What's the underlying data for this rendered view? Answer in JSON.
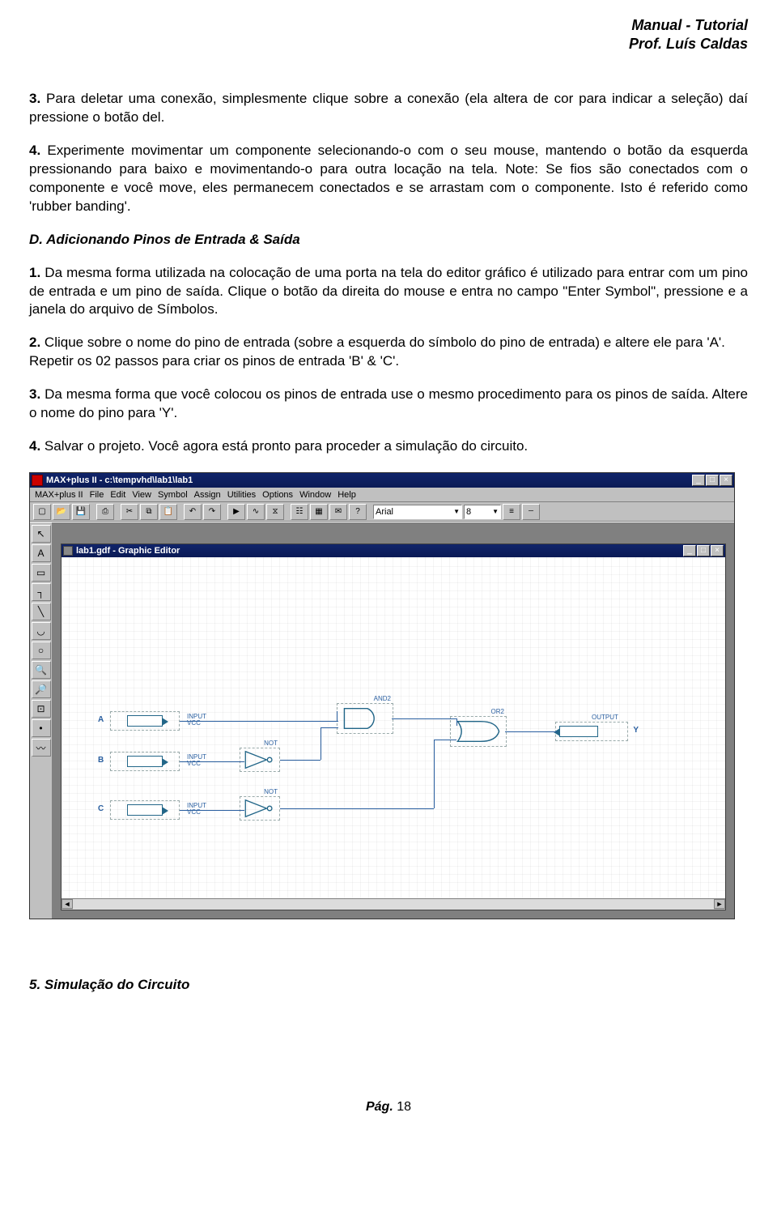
{
  "header": {
    "line1": "Manual - Tutorial",
    "line2": "Prof. Luís Caldas"
  },
  "paragraphs": {
    "p3_num": "3.",
    "p3_text": " Para deletar uma conexão, simplesmente clique sobre a conexão (ela altera de cor para indicar a seleção) daí pressione o botão del.",
    "p4_num": "4.",
    "p4_text": " Experimente movimentar um componente selecionando-o com o seu mouse, mantendo o botão da esquerda pressionando para baixo e movimentando-o para outra locação na tela. Note: Se fios são conectados com o componente e você move, eles permanecem conectados e se arrastam com o componente. Isto é referido como  'rubber banding'.",
    "sectionD": "D. Adicionando Pinos de Entrada & Saída",
    "d1_num": "1.",
    "d1_text": " Da mesma forma utilizada na colocação de uma porta na tela do editor gráfico é utilizado para entrar com um pino de entrada e um pino de saída. Clique o botão da direita do mouse e entra no campo \"Enter Symbol\", pressione e a janela do arquivo de Símbolos.",
    "d2_num": "2.",
    "d2_text_a": " Clique sobre o nome do pino de entrada (sobre a esquerda do símbolo do pino de entrada) e altere ele para 'A'.",
    "d2_text_b": "Repetir os 02 passos para criar os pinos de entrada 'B' & 'C'.",
    "d3_num": "3.",
    "d3_text": " Da mesma forma que você colocou os pinos de entrada use o mesmo procedimento para os pinos de saída. Altere o nome do pino para 'Y'.",
    "d4_num": "4.",
    "d4_text": " Salvar o projeto. Você agora está pronto para proceder a simulação do circuito.",
    "section5": "5. Simulação do Circuito"
  },
  "app": {
    "title": "MAX+plus II - c:\\tempvhd\\lab1\\lab1",
    "menubar": [
      "MAX+plus II",
      "File",
      "Edit",
      "View",
      "Symbol",
      "Assign",
      "Utilities",
      "Options",
      "Window",
      "Help"
    ],
    "font_select": "Arial",
    "size_select": "8",
    "child_title": "lab1.gdf - Graphic Editor",
    "pins": {
      "a": "A",
      "b": "B",
      "c": "C",
      "y": "Y",
      "input_tag": "INPUT",
      "vcc_tag": "VCC"
    },
    "gates": {
      "and2": "AND2",
      "not1": "NOT",
      "not2": "NOT",
      "or2": "OR2",
      "output_tag": "OUTPUT"
    }
  },
  "footer": {
    "label": "Pág.",
    "num": "18"
  }
}
